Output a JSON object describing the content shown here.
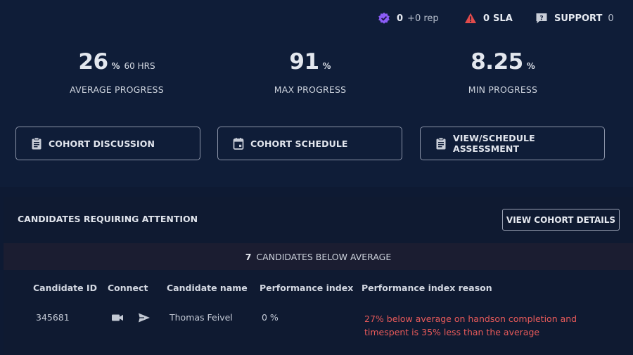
{
  "status_bar": {
    "rep": {
      "icon": "verified-badge-icon",
      "count": "0",
      "text": "+0 rep",
      "color": "#8b5cf6"
    },
    "sla": {
      "icon": "warning-triangle-icon",
      "count": "0",
      "text": "SLA",
      "color": "#e14b4b"
    },
    "support": {
      "icon": "support-chat-icon",
      "label": "SUPPORT",
      "count": "0"
    }
  },
  "stats": {
    "average": {
      "value": "26",
      "unit": "%",
      "extra": "60 HRS",
      "label": "AVERAGE PROGRESS"
    },
    "max": {
      "value": "91",
      "unit": "%",
      "label": "MAX PROGRESS"
    },
    "min": {
      "value": "8.25",
      "unit": "%",
      "label": "MIN PROGRESS"
    }
  },
  "actions": {
    "discussion": {
      "label": "COHORT DISCUSSION",
      "icon": "clipboard-icon"
    },
    "schedule": {
      "label": "COHORT SCHEDULE",
      "icon": "calendar-icon"
    },
    "assessment": {
      "label": "VIEW/SCHEDULE ASSESSMENT",
      "icon": "clipboard-icon"
    }
  },
  "attention": {
    "title": "CANDIDATES REQUIRING ATTENTION",
    "details_button": "VIEW COHORT DETAILS",
    "below_count": "7",
    "below_text": "CANDIDATES BELOW AVERAGE"
  },
  "table": {
    "columns": [
      "Candidate ID",
      "Connect",
      "Candidate name",
      "Performance index",
      "Performance index reason"
    ],
    "rows": [
      {
        "id": "345681",
        "connect_icons": [
          "video-camera-icon",
          "send-icon"
        ],
        "name": "Thomas Feivel",
        "performance": "0 %",
        "reason": "27% below average on handson completion and timespent is 35% less than the average"
      }
    ]
  },
  "colors": {
    "background": "#0e1a33",
    "reason_text": "#e85a5a"
  }
}
